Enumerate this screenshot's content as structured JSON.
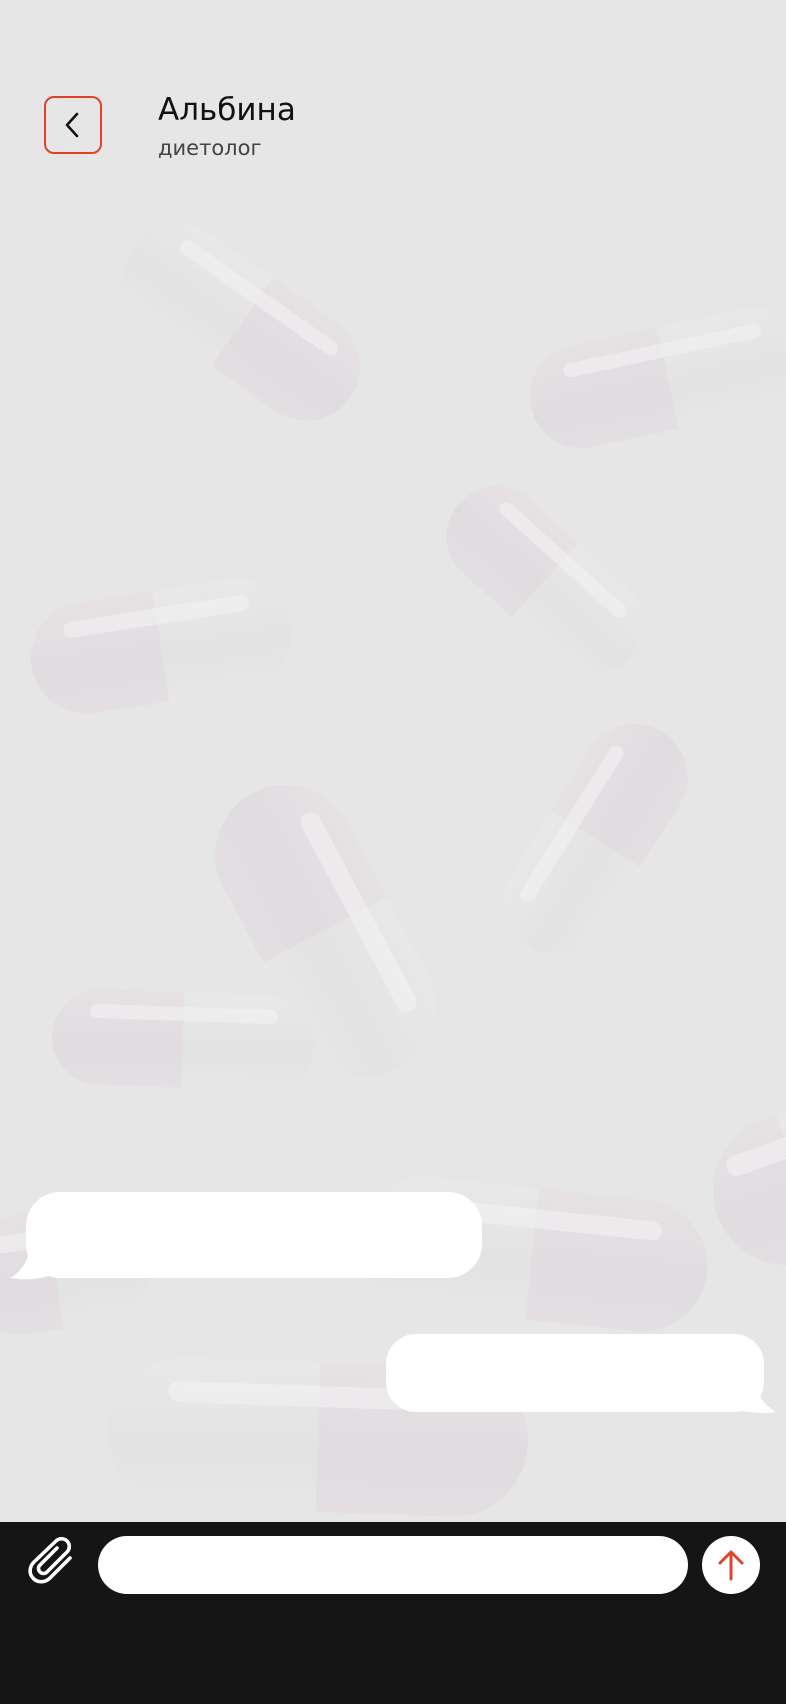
{
  "header": {
    "name": "Альбина",
    "role": "диетолог"
  },
  "composer": {
    "placeholder": "",
    "value": ""
  },
  "icons": {
    "back": "chevron-left-icon",
    "attach": "paperclip-icon",
    "send": "arrow-up-icon"
  },
  "colors": {
    "accent": "#e0432a",
    "background": "#e6e6e6",
    "bottom_bar": "#151515",
    "bubble": "#ffffff"
  }
}
